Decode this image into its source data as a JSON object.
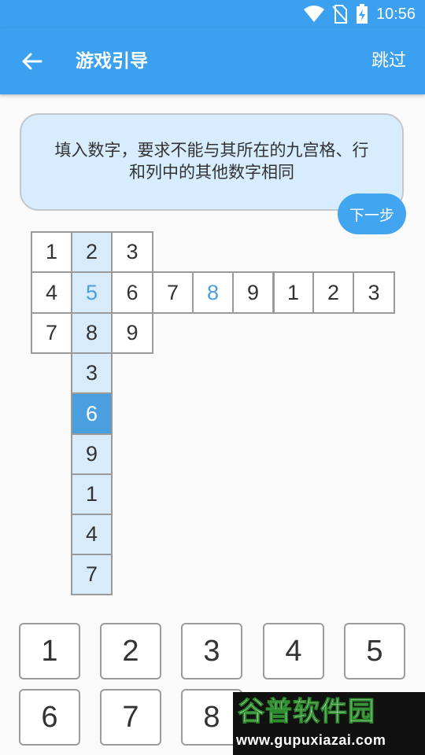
{
  "status_bar": {
    "time": "10:56",
    "icons": [
      "wifi-icon",
      "no-sim-icon",
      "battery-charging-icon"
    ]
  },
  "header": {
    "title": "游戏引导",
    "skip_label": "跳过",
    "back_icon": "arrow-left-icon"
  },
  "guide": {
    "text": "填入数字，要求不能与其所在的九宫格、行和列中的其他数字相同",
    "next_label": "下一步"
  },
  "board": {
    "top_box": [
      [
        "1",
        "2",
        "3"
      ],
      [
        "4",
        "5",
        "6"
      ],
      [
        "7",
        "8",
        "9"
      ]
    ],
    "row_extension": [
      "7",
      "8",
      "9",
      "1",
      "2",
      "3"
    ],
    "column_extension": [
      "3",
      "6",
      "9",
      "1",
      "4",
      "7"
    ]
  },
  "keypad": [
    "1",
    "2",
    "3",
    "4",
    "5",
    "6",
    "7",
    "8"
  ],
  "watermark": {
    "logo": "谷普软件园",
    "url": "www.gupuxiazai.com"
  },
  "colors": {
    "primary": "#3aa0ef",
    "highlight": "#d7ebfb",
    "selected": "#4a9fde"
  }
}
